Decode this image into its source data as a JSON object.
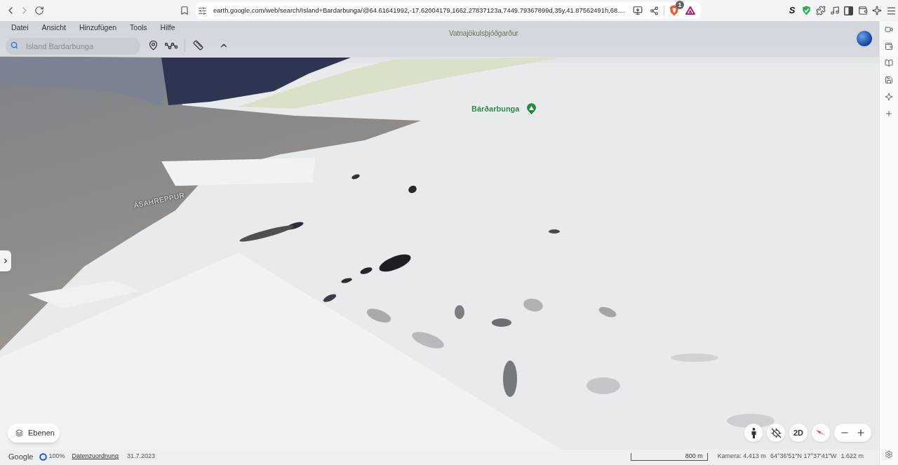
{
  "browser": {
    "url": "earth.google.com/web/search/Island+Bardarbunga/@64.61641992,-17.62004179,1662.27837123a,7449.79367899d,35y,41.87562491h,68....",
    "shields_badge": "1",
    "extension_letter": "S"
  },
  "menu": [
    "Datei",
    "Ansicht",
    "Hinzufügen",
    "Tools",
    "Hilfe"
  ],
  "search": {
    "placeholder": "Island Bardarbunga"
  },
  "map_labels": [
    {
      "kind": "park",
      "text": "Vatnajökulsþjóðgarður"
    },
    {
      "kind": "peak",
      "text": "Bárðarbunga"
    },
    {
      "kind": "region",
      "text": "ÁSAHREPPUR"
    }
  ],
  "layers_button": {
    "label": "Ebenen"
  },
  "view_controls": {
    "mode_label": "2D"
  },
  "status_bar": {
    "logo": "Google",
    "loading": "100%",
    "attribution": "Datenzuordnung",
    "date": "31.7.2023",
    "scale": "800 m",
    "camera": "Kamera: 4.413 m",
    "coordinates": "64°36'51\"N 17°37'41\"W",
    "elevation": "1.622 m"
  }
}
